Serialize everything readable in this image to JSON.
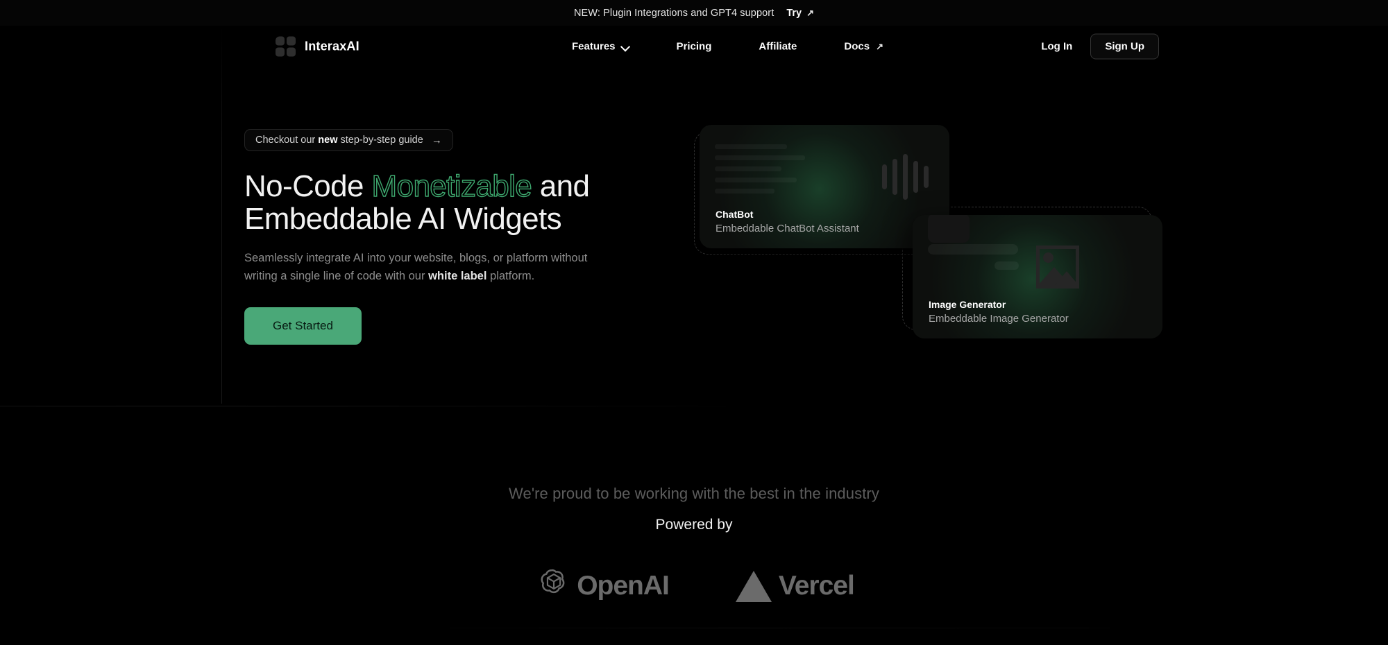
{
  "banner": {
    "text": "NEW: Plugin Integrations and GPT4 support",
    "cta_label": "Try",
    "cta_icon": "arrow-up-right-icon"
  },
  "nav": {
    "brand": "InteraxAI",
    "brand_icon": "grid-logo-icon",
    "items": [
      {
        "label": "Features",
        "icon": "chevron-down-icon"
      },
      {
        "label": "Pricing",
        "icon": ""
      },
      {
        "label": "Affiliate",
        "icon": ""
      },
      {
        "label": "Docs",
        "icon": "arrow-up-right-icon"
      }
    ],
    "login_label": "Log In",
    "signup_label": "Sign Up"
  },
  "hero": {
    "badge_prefix": "Checkout our",
    "badge_emphasis": "new",
    "badge_suffix": "step-by-step guide",
    "badge_arrow": "→",
    "title_line1_a": "No-Code",
    "title_highlight": "Monetizable",
    "title_line1_b": "and",
    "title_line2": "Embeddable AI Widgets",
    "sub_a": "Seamlessly integrate AI into your website, blogs, or platform without writing a single line of code with our",
    "sub_emphasis": "white label",
    "sub_b": "platform.",
    "cta_label": "Get Started"
  },
  "showcase": {
    "cards": [
      {
        "title": "ChatBot",
        "desc": "Embeddable ChatBot Assistant",
        "icon": "waveform-icon"
      },
      {
        "title": "Image Generator",
        "desc": "Embeddable Image Generator",
        "icon": "picture-icon"
      }
    ]
  },
  "partners": {
    "lead": "We're proud to be working with the best in the industry",
    "sub": "Powered by",
    "logos": [
      {
        "name": "OpenAI",
        "icon": "openai-icon"
      },
      {
        "name": "Vercel",
        "icon": "vercel-triangle-icon"
      }
    ]
  },
  "colors": {
    "background": "#000000",
    "accent_green": "#4aa878",
    "outline_green": "#3ea96f",
    "muted_text": "#8d8d8d",
    "logo_gray": "#6b6b6b"
  }
}
